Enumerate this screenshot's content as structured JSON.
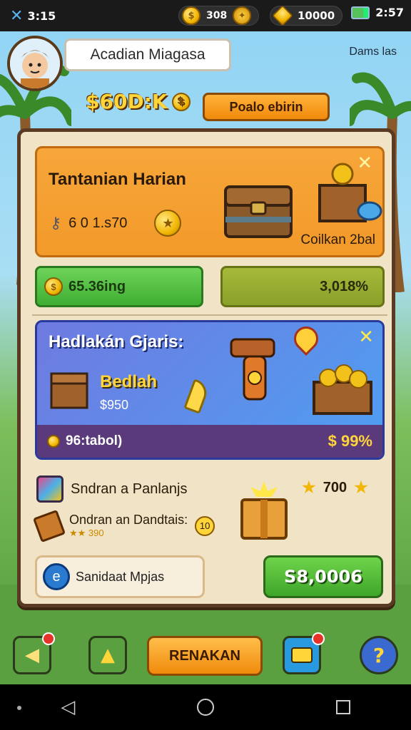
{
  "status_bar": {
    "left_value": "3:15",
    "pill1_value": "308",
    "pill2_value": "10000",
    "time": "2:57"
  },
  "profile": {
    "name": "Acadian Miagasa",
    "top_right_label": "Dams las"
  },
  "header": {
    "currency_value": "$60D:K",
    "button_label": "Poalo ebirin"
  },
  "daily_card": {
    "title": "Tantanian Harian",
    "progress_text": "6 0 1.s70",
    "reward_label": "Coilkan 2bal",
    "bar_left": "65.36ing",
    "bar_right": "3,018%"
  },
  "blue_card": {
    "title": "Hadlakán Gjaris:",
    "item_name": "Bedlah",
    "item_price": "$950",
    "footer_left": "96:tabol)",
    "footer_right": "$ 99%"
  },
  "lower": {
    "row1_label": "Sndran a Panlanjs",
    "row1_value": "700",
    "row2_label": "Ondran an Dandtais:",
    "row2_badge": "10",
    "row2_stars": "390",
    "input_label": "Sanidaat Mpjas",
    "green_button": "S8,0006"
  },
  "bottom": {
    "action_button": "RENAKAN"
  },
  "colors": {
    "accent_orange": "#f29a2a",
    "accent_green": "#3fae32",
    "accent_blue": "#4e9ff2",
    "panel_bg": "#f1e4c6"
  },
  "icons": [
    "x-icon",
    "coin-icon",
    "gem-icon",
    "battery-icon",
    "chest-icon",
    "star-icon",
    "gift-icon",
    "close-icon",
    "back-icon",
    "home-icon",
    "recents-icon"
  ]
}
